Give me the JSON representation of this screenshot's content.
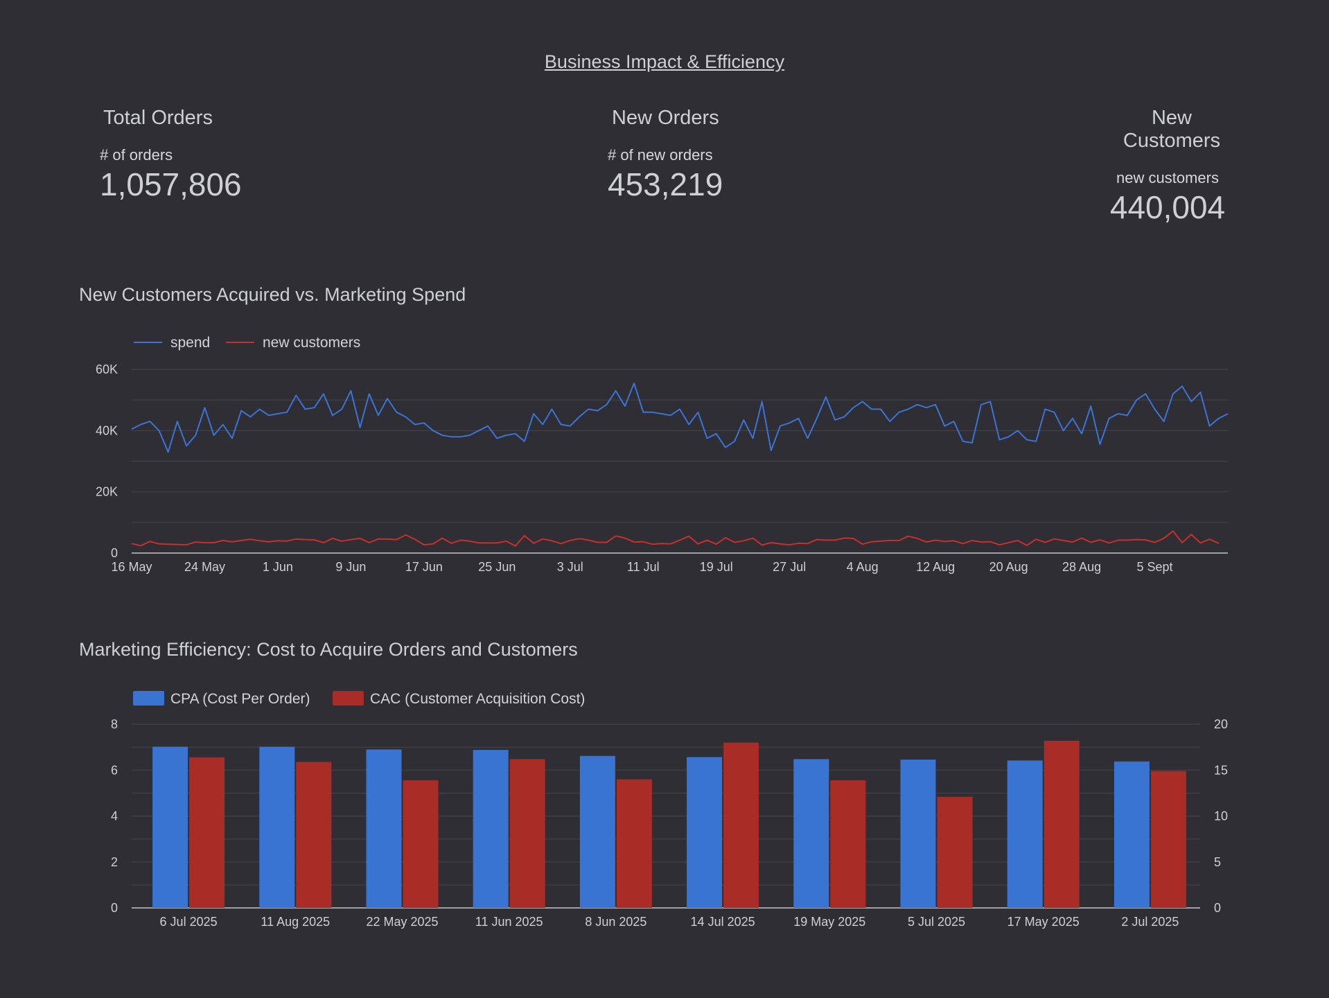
{
  "page": {
    "title": "Business Impact & Efficiency"
  },
  "kpis": [
    {
      "title": "Total Orders",
      "label": "# of orders",
      "value": "1,057,806"
    },
    {
      "title": "New Orders",
      "label": "# of new orders",
      "value": "453,219"
    },
    {
      "title": "New Customers",
      "label": "new customers",
      "value": "440,004"
    }
  ],
  "colors": {
    "background": "#2e2e34",
    "spend": "#3b74d4",
    "new_customers": "#c7302c",
    "cpa": "#3a74d2",
    "cac": "#a92c27"
  },
  "chart_data": [
    {
      "type": "line",
      "title": "New Customers Acquired vs. Marketing Spend",
      "legend_position": "top-left",
      "grid": true,
      "xlabel": "",
      "ylabel": "",
      "x_start": "16 May",
      "x_end": "10 Sept",
      "x_tick_labels": [
        "16 May",
        "24 May",
        "1 Jun",
        "9 Jun",
        "17 Jun",
        "25 Jun",
        "3 Jul",
        "11 Jul",
        "19 Jul",
        "27 Jul",
        "4 Aug",
        "12 Aug",
        "20 Aug",
        "28 Aug",
        "5 Sept"
      ],
      "y_tick_labels": [
        "0",
        "20K",
        "40K",
        "60K"
      ],
      "ylim": [
        0,
        60000
      ],
      "series": [
        {
          "name": "spend",
          "values": [
            40500,
            42000,
            43000,
            40000,
            33000,
            43000,
            35000,
            38500,
            47500,
            38500,
            42000,
            37500,
            46500,
            44500,
            47000,
            45000,
            45500,
            46000,
            51500,
            47000,
            47500,
            52000,
            45000,
            47000,
            53000,
            41000,
            52000,
            45000,
            50500,
            46000,
            44500,
            42000,
            42500,
            40000,
            38500,
            38000,
            38000,
            38500,
            40000,
            41500,
            37500,
            38500,
            39000,
            36500,
            45500,
            42000,
            47000,
            42000,
            41500,
            44500,
            47000,
            46500,
            48500,
            53000,
            48000,
            55500,
            46000,
            46000,
            45500,
            45000,
            47000,
            42000,
            46000,
            37500,
            39000,
            34500,
            36500,
            43500,
            37500,
            49500,
            33500,
            41500,
            42500,
            44000,
            37500,
            44000,
            51000,
            43500,
            44500,
            47500,
            49500,
            47000,
            47000,
            43000,
            46000,
            47000,
            48500,
            47500,
            48500,
            41500,
            43000,
            36500,
            36000,
            48500,
            49500,
            37000,
            38000,
            40000,
            37000,
            36500,
            47000,
            46000,
            40000,
            44000,
            39000,
            48000,
            35500,
            44000,
            45500,
            45000,
            50000,
            52000,
            47000,
            43000,
            52000,
            54500,
            49500,
            52500,
            41500,
            44000,
            45500
          ],
          "tooltip": ""
        },
        {
          "name": "new customers",
          "values": [
            3100,
            2400,
            3800,
            3000,
            2900,
            2800,
            2700,
            3600,
            3400,
            3400,
            4100,
            3700,
            4100,
            4500,
            4000,
            3700,
            4000,
            3900,
            4600,
            4400,
            4300,
            3400,
            4800,
            3900,
            4400,
            4800,
            3400,
            4600,
            4600,
            4400,
            5900,
            4500,
            2700,
            3000,
            4900,
            3200,
            4200,
            3900,
            3300,
            3300,
            3300,
            3900,
            2300,
            5700,
            3200,
            4600,
            4000,
            3100,
            4100,
            4700,
            4200,
            3500,
            3500,
            5600,
            4900,
            3600,
            3700,
            2900,
            3100,
            3000,
            4200,
            5500,
            3000,
            4200,
            2900,
            5000,
            3500,
            4000,
            4900,
            2600,
            3400,
            3000,
            2700,
            3200,
            3100,
            4400,
            4200,
            4200,
            4900,
            4800,
            2900,
            3700,
            3900,
            4100,
            4100,
            5500,
            4800,
            3600,
            4200,
            3800,
            4000,
            3100,
            4100,
            3600,
            3700,
            2700,
            3400,
            4100,
            2500,
            4500,
            3500,
            4600,
            4100,
            3600,
            4900,
            3500,
            4300,
            3300,
            4200,
            4200,
            4400,
            4300,
            3500,
            4800,
            7200,
            3400,
            6100,
            3300,
            4500,
            3200
          ],
          "tooltip": ""
        }
      ]
    },
    {
      "type": "bar",
      "title": "Marketing Efficiency: Cost to Acquire Orders and Customers",
      "legend_position": "top-left",
      "grid": true,
      "xlabel": "",
      "ylabel": "",
      "categories": [
        "6 Jul 2025",
        "11 Aug 2025",
        "22 May 2025",
        "11 Jun 2025",
        "8 Jun 2025",
        "14 Jul 2025",
        "19 May 2025",
        "5 Jul 2025",
        "17 May 2025",
        "2 Jul 2025"
      ],
      "ylim_left": [
        0,
        8
      ],
      "ylim_right": [
        0,
        20
      ],
      "y_left_tick_labels": [
        "0",
        "2",
        "4",
        "6",
        "8"
      ],
      "y_right_tick_labels": [
        "0",
        "5",
        "10",
        "15",
        "20"
      ],
      "series": [
        {
          "name": "CPA (Cost Per Order)",
          "axis": "left",
          "values": [
            7.02,
            7.02,
            6.9,
            6.88,
            6.62,
            6.57,
            6.48,
            6.46,
            6.42,
            6.38
          ]
        },
        {
          "name": "CAC (Customer Acquisition Cost)",
          "axis": "right",
          "values": [
            16.4,
            15.9,
            13.9,
            16.2,
            14.0,
            18.0,
            13.9,
            12.1,
            18.2,
            14.9
          ]
        }
      ]
    }
  ]
}
